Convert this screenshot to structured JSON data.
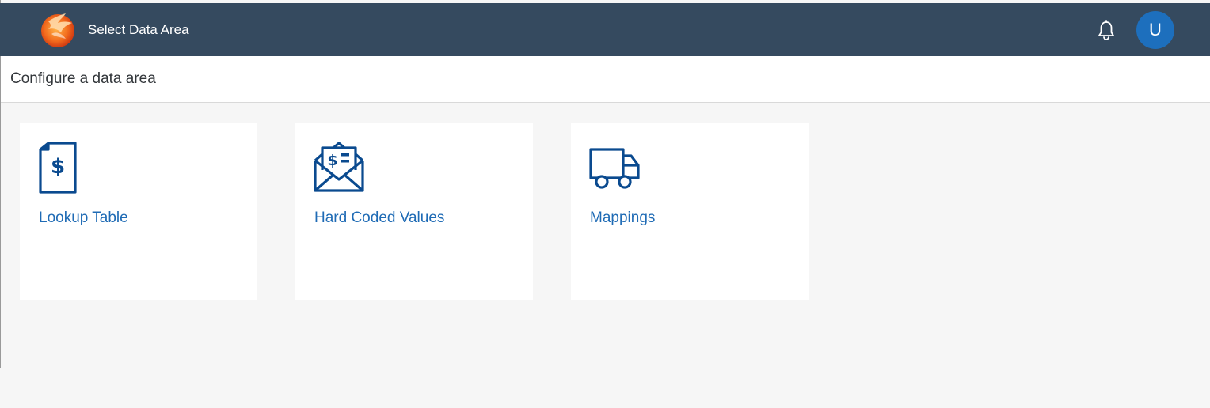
{
  "shell": {
    "title": "Select Data Area",
    "avatar_initial": "U",
    "bg_color": "#354a5f",
    "avatar_color": "#1d6fbd"
  },
  "subheader": {
    "title": "Configure a data area"
  },
  "tiles": [
    {
      "label": "Lookup Table",
      "icon": "document-dollar-icon"
    },
    {
      "label": "Hard Coded Values",
      "icon": "envelope-dollar-icon"
    },
    {
      "label": "Mappings",
      "icon": "truck-icon"
    }
  ],
  "colors": {
    "accent": "#1f6bb5",
    "page_bg": "#f6f6f6"
  }
}
